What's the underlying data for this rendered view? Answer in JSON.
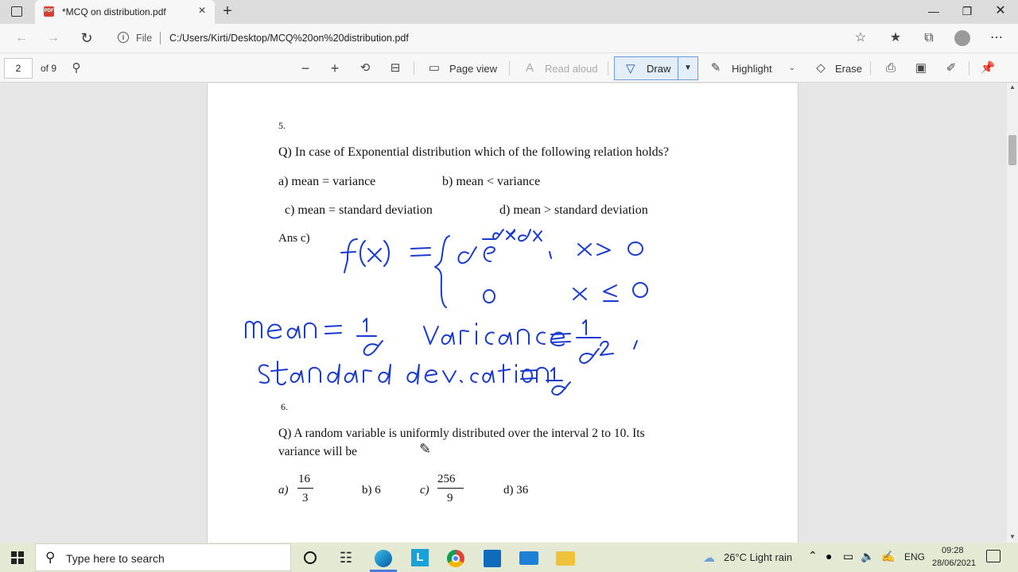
{
  "browser": {
    "tab_title": "*MCQ on distribution.pdf",
    "file_label": "File",
    "url": "C:/Users/Kirti/Desktop/MCQ%20on%20distribution.pdf"
  },
  "pdf_toolbar": {
    "page_number": "2",
    "page_total": "of 9",
    "page_view": "Page view",
    "read_aloud": "Read aloud",
    "draw": "Draw",
    "highlight": "Highlight",
    "erase": "Erase"
  },
  "document": {
    "q5_number": "5.",
    "q5_question": "Q) In case of Exponential distribution which of the following relation holds?",
    "q5_a": "a) mean = variance",
    "q5_b": "b) mean < variance",
    "q5_c": "c) mean = standard deviation",
    "q5_d": "d) mean > standard deviation",
    "q5_ans": "Ans c)",
    "q6_number": "6.",
    "q6_question_line1": "Q) A random variable is uniformly distributed over the interval 2 to 10. Its",
    "q6_question_line2": "variance will be",
    "q6_a_label": "a)",
    "q6_a_num": "16",
    "q6_a_den": "3",
    "q6_b": "b) 6",
    "q6_c_label": "c)",
    "q6_c_num": "256",
    "q6_c_den": "9",
    "q6_d": "d) 36",
    "handwriting": {
      "line1": "f(x) = { αe^−αx , x>0",
      "line2": "0   x ≤ 0",
      "line3": "mean = 1/α   Variance = 1/α² ,",
      "line4": "standard deviation = 1/α"
    }
  },
  "taskbar": {
    "search_placeholder": "Type here to search",
    "weather": "26°C  Light rain",
    "language": "ENG",
    "time": "09:28",
    "date": "28/06/2021"
  },
  "colors": {
    "ink": "#1a3bd1",
    "accent": "#1d5fb8",
    "taskbar": "#e4e9d4"
  }
}
